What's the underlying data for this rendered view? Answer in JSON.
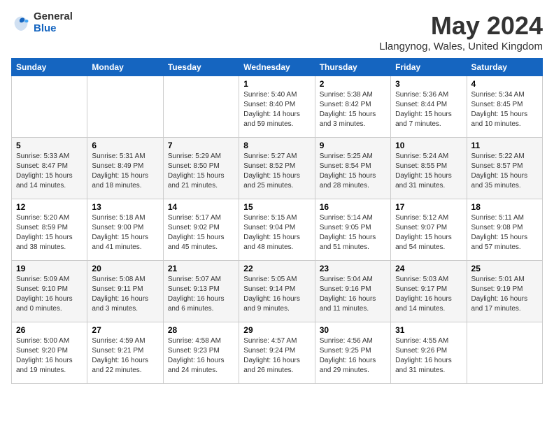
{
  "header": {
    "logo_general": "General",
    "logo_blue": "Blue",
    "month_year": "May 2024",
    "location": "Llangynog, Wales, United Kingdom"
  },
  "calendar": {
    "days_of_week": [
      "Sunday",
      "Monday",
      "Tuesday",
      "Wednesday",
      "Thursday",
      "Friday",
      "Saturday"
    ],
    "weeks": [
      [
        {
          "day": "",
          "info": ""
        },
        {
          "day": "",
          "info": ""
        },
        {
          "day": "",
          "info": ""
        },
        {
          "day": "1",
          "info": "Sunrise: 5:40 AM\nSunset: 8:40 PM\nDaylight: 14 hours\nand 59 minutes."
        },
        {
          "day": "2",
          "info": "Sunrise: 5:38 AM\nSunset: 8:42 PM\nDaylight: 15 hours\nand 3 minutes."
        },
        {
          "day": "3",
          "info": "Sunrise: 5:36 AM\nSunset: 8:44 PM\nDaylight: 15 hours\nand 7 minutes."
        },
        {
          "day": "4",
          "info": "Sunrise: 5:34 AM\nSunset: 8:45 PM\nDaylight: 15 hours\nand 10 minutes."
        }
      ],
      [
        {
          "day": "5",
          "info": "Sunrise: 5:33 AM\nSunset: 8:47 PM\nDaylight: 15 hours\nand 14 minutes."
        },
        {
          "day": "6",
          "info": "Sunrise: 5:31 AM\nSunset: 8:49 PM\nDaylight: 15 hours\nand 18 minutes."
        },
        {
          "day": "7",
          "info": "Sunrise: 5:29 AM\nSunset: 8:50 PM\nDaylight: 15 hours\nand 21 minutes."
        },
        {
          "day": "8",
          "info": "Sunrise: 5:27 AM\nSunset: 8:52 PM\nDaylight: 15 hours\nand 25 minutes."
        },
        {
          "day": "9",
          "info": "Sunrise: 5:25 AM\nSunset: 8:54 PM\nDaylight: 15 hours\nand 28 minutes."
        },
        {
          "day": "10",
          "info": "Sunrise: 5:24 AM\nSunset: 8:55 PM\nDaylight: 15 hours\nand 31 minutes."
        },
        {
          "day": "11",
          "info": "Sunrise: 5:22 AM\nSunset: 8:57 PM\nDaylight: 15 hours\nand 35 minutes."
        }
      ],
      [
        {
          "day": "12",
          "info": "Sunrise: 5:20 AM\nSunset: 8:59 PM\nDaylight: 15 hours\nand 38 minutes."
        },
        {
          "day": "13",
          "info": "Sunrise: 5:18 AM\nSunset: 9:00 PM\nDaylight: 15 hours\nand 41 minutes."
        },
        {
          "day": "14",
          "info": "Sunrise: 5:17 AM\nSunset: 9:02 PM\nDaylight: 15 hours\nand 45 minutes."
        },
        {
          "day": "15",
          "info": "Sunrise: 5:15 AM\nSunset: 9:04 PM\nDaylight: 15 hours\nand 48 minutes."
        },
        {
          "day": "16",
          "info": "Sunrise: 5:14 AM\nSunset: 9:05 PM\nDaylight: 15 hours\nand 51 minutes."
        },
        {
          "day": "17",
          "info": "Sunrise: 5:12 AM\nSunset: 9:07 PM\nDaylight: 15 hours\nand 54 minutes."
        },
        {
          "day": "18",
          "info": "Sunrise: 5:11 AM\nSunset: 9:08 PM\nDaylight: 15 hours\nand 57 minutes."
        }
      ],
      [
        {
          "day": "19",
          "info": "Sunrise: 5:09 AM\nSunset: 9:10 PM\nDaylight: 16 hours\nand 0 minutes."
        },
        {
          "day": "20",
          "info": "Sunrise: 5:08 AM\nSunset: 9:11 PM\nDaylight: 16 hours\nand 3 minutes."
        },
        {
          "day": "21",
          "info": "Sunrise: 5:07 AM\nSunset: 9:13 PM\nDaylight: 16 hours\nand 6 minutes."
        },
        {
          "day": "22",
          "info": "Sunrise: 5:05 AM\nSunset: 9:14 PM\nDaylight: 16 hours\nand 9 minutes."
        },
        {
          "day": "23",
          "info": "Sunrise: 5:04 AM\nSunset: 9:16 PM\nDaylight: 16 hours\nand 11 minutes."
        },
        {
          "day": "24",
          "info": "Sunrise: 5:03 AM\nSunset: 9:17 PM\nDaylight: 16 hours\nand 14 minutes."
        },
        {
          "day": "25",
          "info": "Sunrise: 5:01 AM\nSunset: 9:19 PM\nDaylight: 16 hours\nand 17 minutes."
        }
      ],
      [
        {
          "day": "26",
          "info": "Sunrise: 5:00 AM\nSunset: 9:20 PM\nDaylight: 16 hours\nand 19 minutes."
        },
        {
          "day": "27",
          "info": "Sunrise: 4:59 AM\nSunset: 9:21 PM\nDaylight: 16 hours\nand 22 minutes."
        },
        {
          "day": "28",
          "info": "Sunrise: 4:58 AM\nSunset: 9:23 PM\nDaylight: 16 hours\nand 24 minutes."
        },
        {
          "day": "29",
          "info": "Sunrise: 4:57 AM\nSunset: 9:24 PM\nDaylight: 16 hours\nand 26 minutes."
        },
        {
          "day": "30",
          "info": "Sunrise: 4:56 AM\nSunset: 9:25 PM\nDaylight: 16 hours\nand 29 minutes."
        },
        {
          "day": "31",
          "info": "Sunrise: 4:55 AM\nSunset: 9:26 PM\nDaylight: 16 hours\nand 31 minutes."
        },
        {
          "day": "",
          "info": ""
        }
      ]
    ]
  }
}
